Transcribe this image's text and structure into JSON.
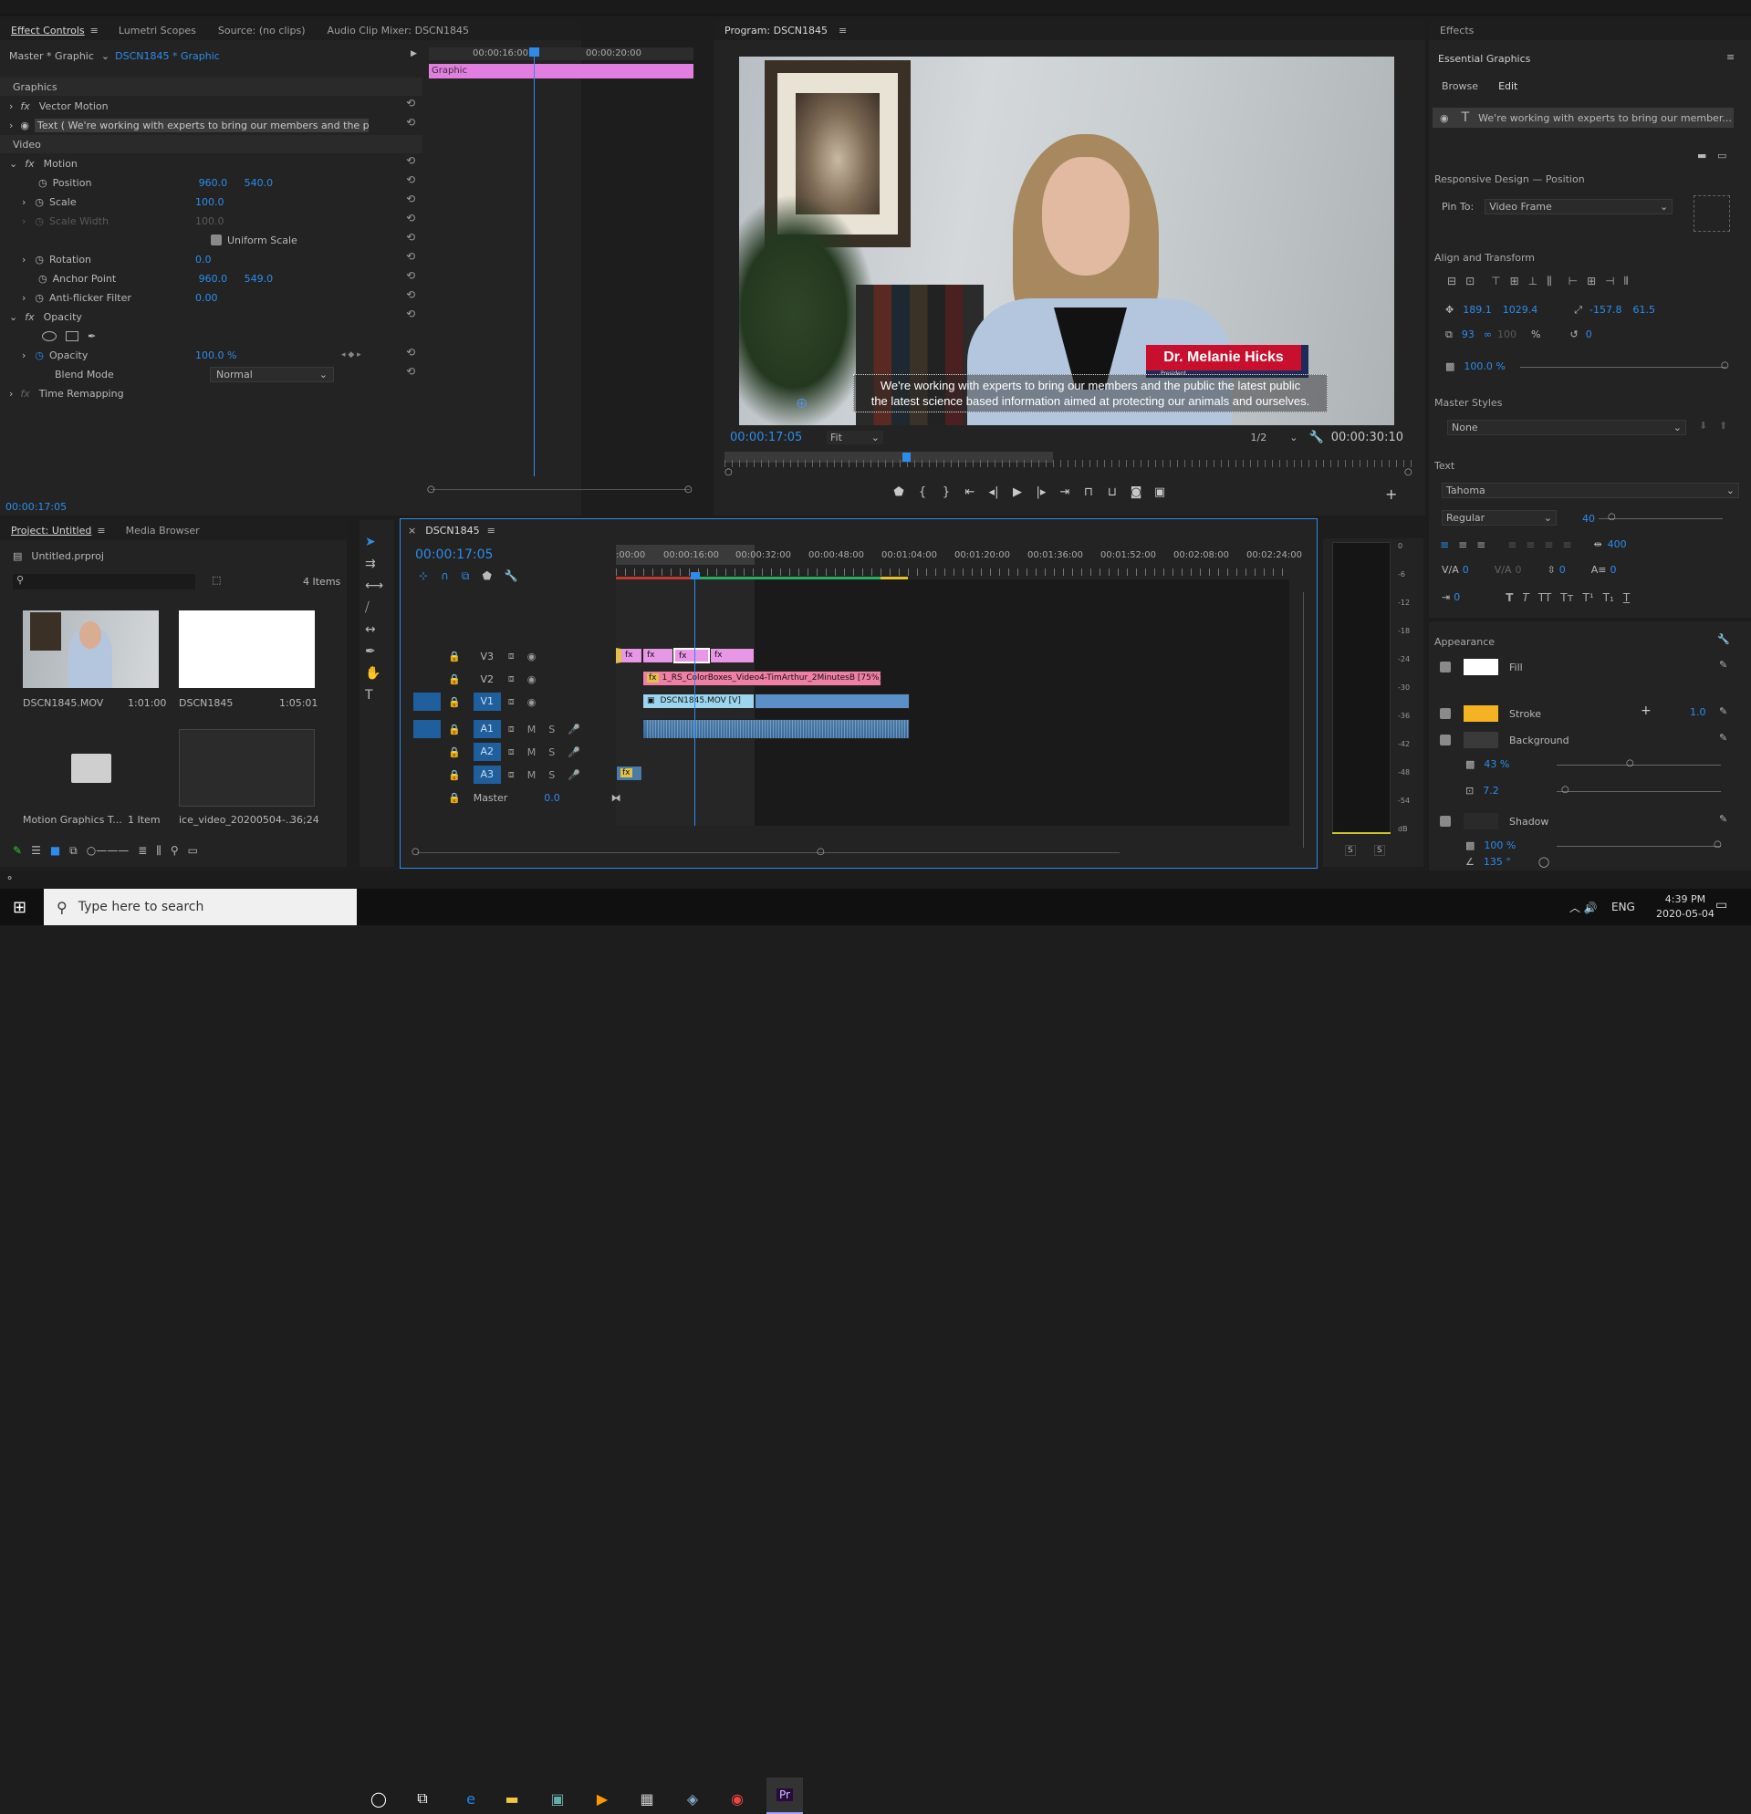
{
  "effect_controls": {
    "tabs": [
      "Effect Controls",
      "Lumetri Scopes",
      "Source: (no clips)",
      "Audio Clip Mixer: DSCN1845"
    ],
    "master": "Master * Graphic",
    "clip": "DSCN1845 * Graphic",
    "ruler": [
      "00:00:16:00",
      "00:00:20:00"
    ],
    "graphic_bar": "Graphic",
    "section_graphics": "Graphics",
    "vector_motion": "Vector Motion",
    "text_layer": "Text (  We're working with experts to bring our members and the public ...",
    "section_video": "Video",
    "motion": "Motion",
    "position": {
      "label": "Position",
      "x": "960.0",
      "y": "540.0"
    },
    "scale": {
      "label": "Scale",
      "value": "100.0"
    },
    "scale_width": {
      "label": "Scale Width",
      "value": "100.0"
    },
    "uniform_scale": "Uniform Scale",
    "rotation": {
      "label": "Rotation",
      "value": "0.0"
    },
    "anchor": {
      "label": "Anchor Point",
      "x": "960.0",
      "y": "549.0"
    },
    "antiflicker": {
      "label": "Anti-flicker Filter",
      "value": "0.00"
    },
    "opacity_fx": "Opacity",
    "opacity": {
      "label": "Opacity",
      "value": "100.0 %"
    },
    "blend": {
      "label": "Blend Mode",
      "value": "Normal"
    },
    "time_remap": "Time Remapping",
    "timecode": "00:00:17:05"
  },
  "program": {
    "title": "Program: DSCN1845",
    "name_title": "Dr. Melanie Hicks",
    "name_subtitle": "President",
    "caption1": "We're working with experts to bring our members and the public the latest public",
    "caption2": "the latest science based information aimed at protecting our animals and ourselves.",
    "timecode": "00:00:17:05",
    "fit": "Fit",
    "resolution": "1/2",
    "duration": "00:00:30:10"
  },
  "essential_graphics": {
    "tab": "Effects",
    "title": "Essential Graphics",
    "browse": "Browse",
    "edit": "Edit",
    "layer": "We're working with experts to bring our member...",
    "responsive": "Responsive Design — Position",
    "pin_to_label": "Pin To:",
    "pin_to": "Video Frame",
    "align": "Align and Transform",
    "pos_x": "189.1",
    "pos_y": "1029.4",
    "anchor_x": "-157.8",
    "anchor_y": "61.5",
    "scale_w": "93",
    "scale_h": "100",
    "pct": "%",
    "rot": "0",
    "opacity": "100.0 %",
    "master_styles": "Master Styles",
    "master_style_value": "None",
    "text": "Text",
    "font": "Tahoma",
    "style": "Regular",
    "size": "40",
    "tracking": "400",
    "kern": "0",
    "lead": "0",
    "base": "0",
    "tsume": "0",
    "tab_w": "0",
    "appearance": "Appearance",
    "fill": "Fill",
    "stroke": "Stroke",
    "stroke_w": "1.0",
    "background": "Background",
    "bg_opacity": "43 %",
    "bg_size": "7.2",
    "shadow": "Shadow",
    "shadow_opacity": "100 %",
    "shadow_angle": "135 °",
    "colors": {
      "fill": "#ffffff",
      "stroke": "#f5b324",
      "bg": "#3a3a3a",
      "accent": "#2d8ceb"
    }
  },
  "project": {
    "tabs": [
      "Project: Untitled",
      "Media Browser"
    ],
    "file": "Untitled.prproj",
    "items": "4 Items",
    "thumbs": [
      {
        "name": "DSCN1845.MOV",
        "dur": "1:01:00"
      },
      {
        "name": "DSCN1845",
        "dur": "1:05:01"
      },
      {
        "name": "Motion Graphics T...",
        "dur": "1 Item"
      },
      {
        "name": "ice_video_20200504-...",
        "dur": "36;24"
      }
    ]
  },
  "timeline": {
    "tab": "DSCN1845",
    "timecode": "00:00:17:05",
    "ruler": [
      ":00:00",
      "00:00:16:00",
      "00:00:32:00",
      "00:00:48:00",
      "00:01:04:00",
      "00:01:20:00",
      "00:01:36:00",
      "00:01:52:00",
      "00:02:08:00",
      "00:02:24:00"
    ],
    "tracks_v": [
      "V3",
      "V2",
      "V1"
    ],
    "tracks_a": [
      "A1",
      "A2",
      "A3"
    ],
    "master": "Master",
    "master_val": "0.0",
    "clip_v2": "1_RS_ColorBoxes_Video4-TimArthur_2MinutesB [75%]",
    "clip_v1": "DSCN1845.MOV [V]"
  },
  "meter": {
    "scale": [
      "0",
      "-6",
      "-12",
      "-18",
      "-24",
      "-30",
      "-36",
      "-42",
      "-48",
      "-54",
      "dB"
    ],
    "solo": "S"
  },
  "taskbar": {
    "search": "Type here to search",
    "lang": "ENG",
    "time": "4:39 PM",
    "date": "2020-05-04"
  }
}
